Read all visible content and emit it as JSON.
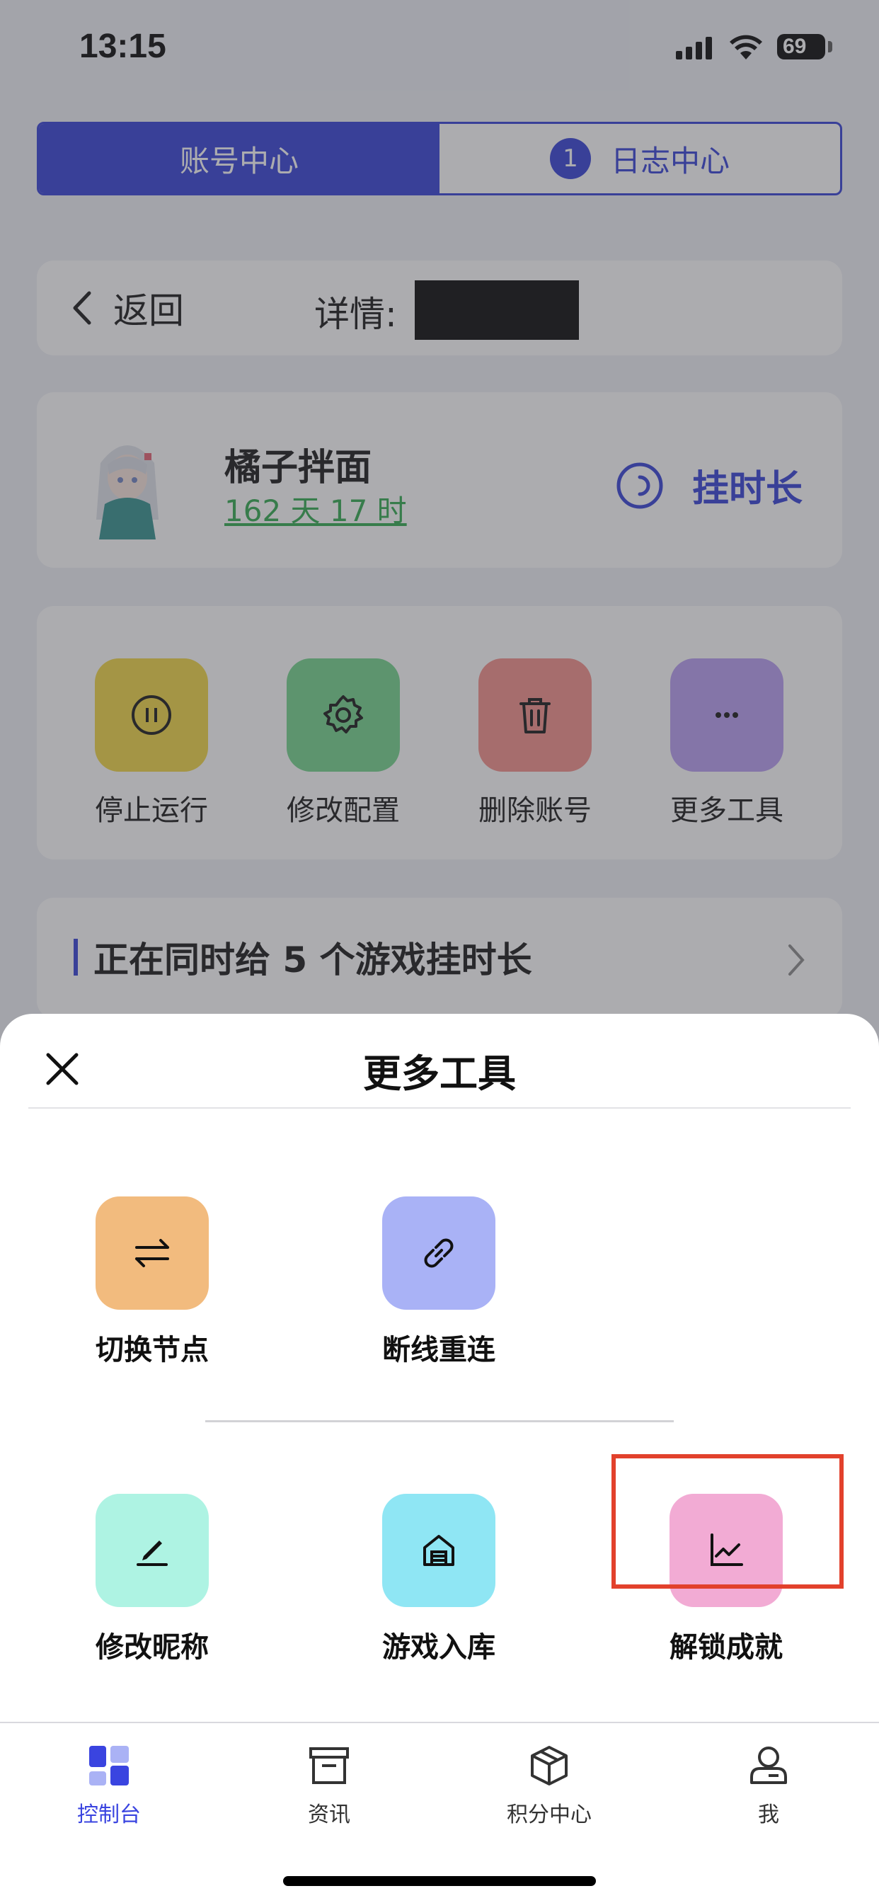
{
  "status_bar": {
    "time": "13:15",
    "battery": "69"
  },
  "segment": {
    "tabs": [
      {
        "label": "账号中心",
        "active": true
      },
      {
        "label": "日志中心",
        "badge": "1",
        "active": false
      }
    ]
  },
  "detail": {
    "back_label": "返回",
    "title_label": "详情:"
  },
  "profile": {
    "nickname": "橘子拌面",
    "duration": "162 天 17 时",
    "hang_button": "挂时长"
  },
  "actions": [
    {
      "label": "停止运行",
      "icon": "pause-icon",
      "color": "#f0d53e"
    },
    {
      "label": "修改配置",
      "icon": "gear-icon",
      "color": "#6fd389"
    },
    {
      "label": "删除账号",
      "icon": "trash-icon",
      "color": "#f58d88"
    },
    {
      "label": "更多工具",
      "icon": "more-icon",
      "color": "#b69cf3"
    }
  ],
  "games_banner": {
    "text": "正在同时给 5 个游戏挂时长"
  },
  "sheet": {
    "title": "更多工具",
    "tools_row1": [
      {
        "label": "切换节点",
        "icon": "swap-icon",
        "color": "#f2bb7e"
      },
      {
        "label": "断线重连",
        "icon": "link-icon",
        "color": "#a9b2f6"
      }
    ],
    "tools_row2": [
      {
        "label": "修改昵称",
        "icon": "pen-icon",
        "color": "#aef3e3"
      },
      {
        "label": "游戏入库",
        "icon": "warehouse-icon",
        "color": "#8fe6f4"
      },
      {
        "label": "解锁成就",
        "icon": "chart-icon",
        "color": "#f2abd4"
      }
    ]
  },
  "tabbar": {
    "tabs": [
      {
        "label": "控制台",
        "icon": "dashboard-icon",
        "active": true
      },
      {
        "label": "资讯",
        "icon": "news-icon",
        "active": false
      },
      {
        "label": "积分中心",
        "icon": "cube-icon",
        "active": false
      },
      {
        "label": "我",
        "icon": "user-icon",
        "active": false
      }
    ]
  },
  "colors": {
    "accent": "#2f3bd6",
    "highlight": "#e2412c",
    "duration_green": "#2aa84a"
  }
}
